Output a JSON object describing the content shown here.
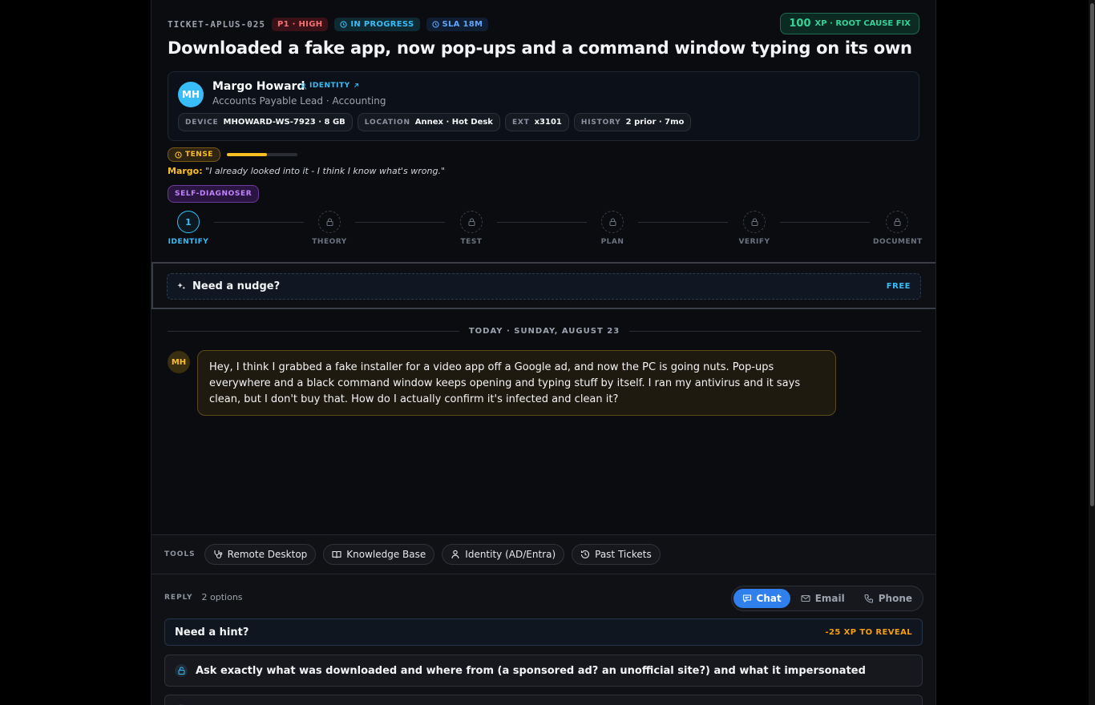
{
  "ticket": {
    "id": "TICKET-APLUS-025",
    "priority": "P1 · HIGH",
    "status": "IN PROGRESS",
    "sla": "SLA 18M",
    "xp_value": "100",
    "xp_label": "XP · ROOT CAUSE FIX",
    "title": "Downloaded a fake app, now pop-ups and a command window typing on its own"
  },
  "caller": {
    "initials": "MH",
    "name": "Margo Howard",
    "identity_link": "IDENTITY",
    "role": "Accounts Payable Lead · Accounting",
    "meta": [
      {
        "key": "DEVICE",
        "value": "MHOWARD-WS-7923 · 8 GB"
      },
      {
        "key": "LOCATION",
        "value": "Annex · Hot Desk"
      },
      {
        "key": "EXT",
        "value": "x3101"
      },
      {
        "key": "HISTORY",
        "value": "2 prior · 7mo"
      }
    ]
  },
  "mood": {
    "label": "TENSE",
    "level": 0.57,
    "color": "#fbbf24"
  },
  "quote": {
    "who": "Margo:",
    "text": "\"I already looked into it - I think I know what's wrong.\""
  },
  "persona_tag": "SELF-DIAGNOSER",
  "steps": [
    {
      "label": "IDENTIFY",
      "marker": "1",
      "state": "active"
    },
    {
      "label": "THEORY",
      "state": "locked"
    },
    {
      "label": "TEST",
      "state": "locked"
    },
    {
      "label": "PLAN",
      "state": "locked"
    },
    {
      "label": "VERIFY",
      "state": "locked"
    },
    {
      "label": "DOCUMENT",
      "state": "locked"
    }
  ],
  "nudge": {
    "label": "Need a nudge?",
    "badge": "FREE"
  },
  "date_separator": "TODAY · SUNDAY, AUGUST 23",
  "message": {
    "initials": "MH",
    "text": "Hey, I think I grabbed a fake installer for a video app off a Google ad, and now the PC is going nuts. Pop-ups everywhere and a black command window keeps opening and typing stuff by itself. I ran my antivirus and it says clean, but I don't buy that. How do I actually confirm it's infected and clean it?"
  },
  "tools": {
    "label": "TOOLS",
    "items": [
      {
        "label": "Remote Desktop",
        "icon": "stethoscope-icon"
      },
      {
        "label": "Knowledge Base",
        "icon": "book-icon"
      },
      {
        "label": "Identity (AD/Entra)",
        "icon": "user-icon"
      },
      {
        "label": "Past Tickets",
        "icon": "history-icon"
      }
    ]
  },
  "reply": {
    "label": "REPLY",
    "options_count": "2 options",
    "channels": [
      {
        "label": "Chat",
        "icon": "chat-icon",
        "active": true
      },
      {
        "label": "Email",
        "icon": "mail-icon",
        "active": false
      },
      {
        "label": "Phone",
        "icon": "phone-icon",
        "active": false
      }
    ],
    "hint": {
      "label": "Need a hint?",
      "cost": "-25 XP TO REVEAL"
    },
    "options": [
      {
        "text": "Ask exactly what was downloaded and where from (a sponsored ad? an unofficial site?) and what it impersonated"
      }
    ]
  },
  "colors": {
    "accent": "#38bdf8",
    "warning": "#fbbf24",
    "chat_active": "#2f80ed",
    "danger": "#f87171",
    "success": "#34d399"
  }
}
